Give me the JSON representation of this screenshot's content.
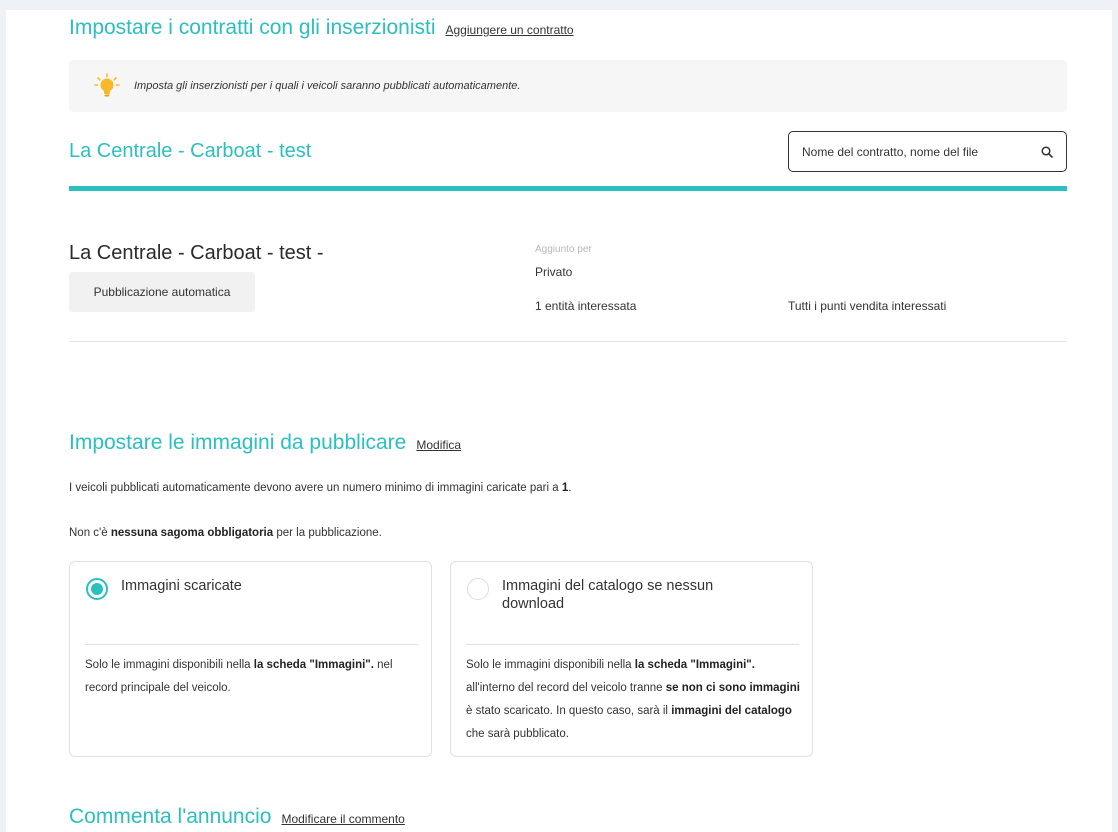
{
  "contracts": {
    "title": "Impostare i contratti con gli inserzionisti",
    "add_link": "Aggiungere un contratto",
    "tip": "Imposta gli inserzionisti per i quali i veicoli saranno pubblicati automaticamente."
  },
  "contract_header": {
    "title": "La Centrale - Carboat - test",
    "search_placeholder": "Nome del contratto, nome del file"
  },
  "contract": {
    "name": "La Centrale - Carboat - test -",
    "badge": "Pubblicazione automatica",
    "added_by_label": "Aggiunto per",
    "added_by_value": "Privato",
    "entities": "1 entità interessata",
    "stores": "Tutti i punti vendita interessati"
  },
  "images": {
    "title": "Impostare le immagini da pubblicare",
    "edit_link": "Modifica",
    "min_text_prefix": "I veicoli pubblicati automaticamente devono avere un numero minimo di immagini caricate pari a ",
    "min_value": "1",
    "min_text_suffix": ".",
    "template_prefix": "Non c'è ",
    "template_bold": "nessuna sagoma obbligatoria",
    "template_suffix": " per la pubblicazione.",
    "options": [
      {
        "title": "Immagini scaricate",
        "selected": true,
        "desc": [
          {
            "t": "Solo le immagini disponibili nella ",
            "b": false
          },
          {
            "t": "la scheda \"Immagini\".",
            "b": true
          },
          {
            "t": " nel record principale del veicolo.",
            "b": false
          }
        ]
      },
      {
        "title": "Immagini del catalogo se nessun download",
        "selected": false,
        "desc": [
          {
            "t": "Solo le immagini disponibili nella ",
            "b": false
          },
          {
            "t": "la scheda \"Immagini\".",
            "b": true
          },
          {
            "t": " all'interno del record del veicolo tranne ",
            "b": false
          },
          {
            "t": "se non ci sono immagini",
            "b": true
          },
          {
            "t": " è stato scaricato. In questo caso, sarà il ",
            "b": false
          },
          {
            "t": "immagini del catalogo",
            "b": true
          },
          {
            "t": " che sarà pubblicato.",
            "b": false
          }
        ]
      }
    ]
  },
  "comment": {
    "title": "Commenta l'annuncio",
    "edit_link": "Modificare il commento"
  },
  "colors": {
    "accent": "#2bbfbf",
    "bulb": "#f7b928"
  },
  "icons": {
    "tip": "lightbulb-icon",
    "search": "search-icon"
  }
}
